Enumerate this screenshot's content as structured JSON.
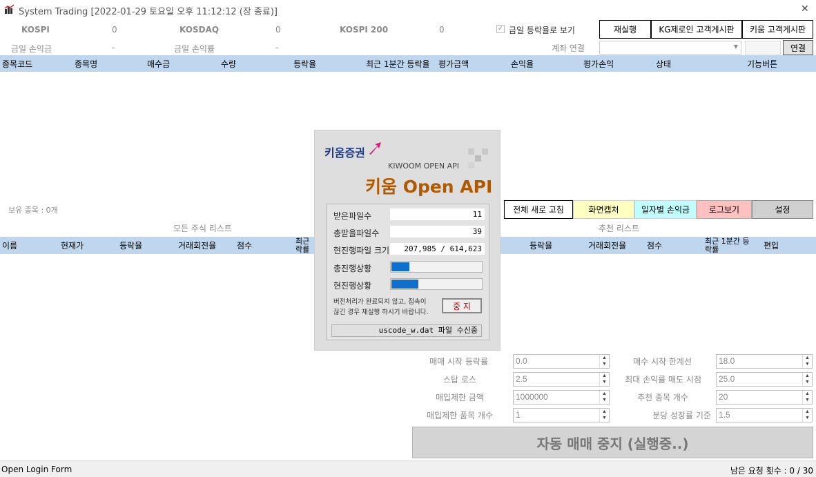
{
  "window": {
    "title": "System Trading [2022-01-29 토요일 오후 11:12:12 (장 종료)]",
    "close_glyph": "✕"
  },
  "market": {
    "kospi_label": "KOSPI",
    "kospi_value": "0",
    "kosdaq_label": "KOSDAQ",
    "kosdaq_value": "0",
    "kospi200_label": "KOSPI 200",
    "kospi200_value": "0",
    "today_pl_label": "금일 손익금",
    "today_pl_value": "-",
    "today_plr_label": "금일 손익률",
    "today_plr_value": "-"
  },
  "options": {
    "show_today_change_label": "금일 등락율로 보기",
    "show_today_change_checked": true
  },
  "toolbar": {
    "rerun": "재실행",
    "kg_board": "KG제로인 고객게시판",
    "kiwoom_board": "키움 고객게시판",
    "account_label": "계좌 연결",
    "connect": "연결"
  },
  "holdings": {
    "columns": [
      "종목코드",
      "종목명",
      "매수금",
      "수량",
      "등락율",
      "최근 1분간 등락율",
      "평가금액",
      "손익율",
      "평가손익",
      "상태",
      "기능버튼"
    ],
    "count_label": "보유 종목 : 0개"
  },
  "actions": {
    "refresh_all": "전체 새로 고침",
    "capture": "화면캡처",
    "daily_pl": "일자별 손익금",
    "log": "로그보기",
    "settings": "설정"
  },
  "all_stocks": {
    "title": "모든 주식 리스트",
    "columns": [
      "이름",
      "현재가",
      "등락율",
      "거래회전율",
      "점수",
      "최근 락률"
    ]
  },
  "recommend": {
    "title": "추천 리스트",
    "columns": [
      "등락율",
      "거래회전율",
      "점수",
      "최근 1분간 등 락률",
      "편입"
    ]
  },
  "params": {
    "buy_start_rate_label": "매매 시작 등락률",
    "buy_start_rate": "0.0",
    "buy_start_limit_label": "매수 시작 한계선",
    "buy_start_limit": "18.0",
    "stop_loss_label": "스탑 로스",
    "stop_loss": "2.5",
    "max_pl_sell_label": "최대 손익률 매도 시점",
    "max_pl_sell": "25.0",
    "buy_limit_amount_label": "매입제한 금액",
    "buy_limit_amount": "1000000",
    "recommend_count_label": "추천 종목 개수",
    "recommend_count": "20",
    "buy_limit_items_label": "매입제한 품목 개수",
    "buy_limit_items": "1",
    "minute_growth_label": "분당 성장률 기준",
    "minute_growth": "1.5"
  },
  "auto_trade": {
    "label": "자동 매매 중지 (실행중..)"
  },
  "status": {
    "left": "Open Login Form",
    "right": "남은 요청 횟수 : 0 / 30"
  },
  "dialog": {
    "brand": "키움증권",
    "api_en": "KIWOOM OPEN API",
    "api_ko": "키움 Open API",
    "received_label": "받은파일수",
    "received_value": "11",
    "total_label": "총받을파일수",
    "total_value": "39",
    "size_label": "현진행파일 크기",
    "size_value": "207,985 / 614,623",
    "total_progress_label": "총진행상황",
    "total_progress": 0.2,
    "current_progress_label": "현진행상황",
    "current_progress": 0.3,
    "notice": "버전처리가 완료되지 않고, 접속이 끊긴 경우 재실행 하시기 바랍니다.",
    "stop": "중 지",
    "file_status": "uscode_w.dat 파일 수신중"
  },
  "colors": {
    "header_bg": "#bed6ee",
    "capture_bg": "#ffffc0",
    "daily_bg": "#c0ffff",
    "log_bg": "#ffc0c0",
    "settings_bg": "#d0d0d0",
    "brand": "#b05a00"
  }
}
